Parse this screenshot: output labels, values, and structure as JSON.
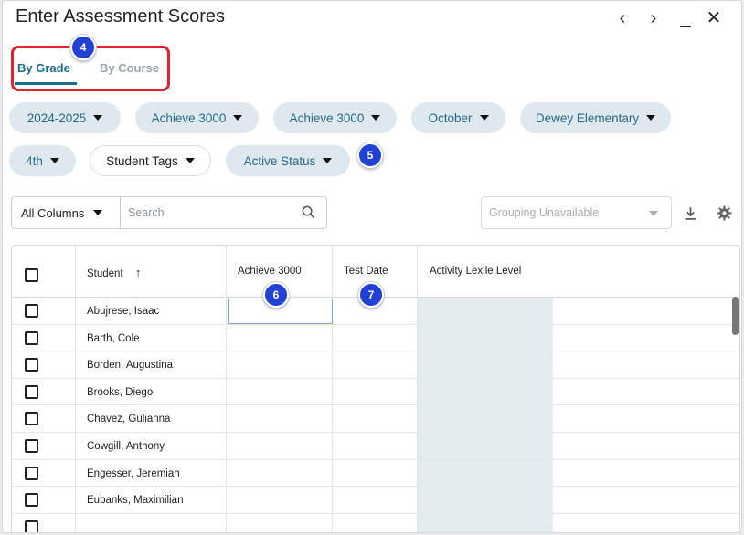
{
  "window": {
    "title": "Enter Assessment Scores",
    "controls": {
      "prev": "‹",
      "next": "›",
      "minimize": "_",
      "close": "✕"
    }
  },
  "tabs": [
    {
      "label": "By Grade",
      "active": true
    },
    {
      "label": "By Course",
      "active": false
    }
  ],
  "badges": [
    "4",
    "5",
    "6",
    "7"
  ],
  "filters": [
    {
      "label": "2024-2025"
    },
    {
      "label": "Achieve 3000"
    },
    {
      "label": "Achieve 3000"
    },
    {
      "label": "October"
    },
    {
      "label": "Dewey Elementary"
    },
    {
      "label": "4th"
    },
    {
      "label": "Student Tags"
    },
    {
      "label": "Active Status"
    }
  ],
  "toolbar": {
    "columns_select": "All Columns",
    "search_placeholder": "Search",
    "grouping": "Grouping Unavailable"
  },
  "table": {
    "columns": [
      "Student",
      "Achieve 3000",
      "Test Date",
      "Activity Lexile Level"
    ],
    "sort_icon": "↑",
    "rows": [
      "Abujrese, Isaac",
      "Barth, Cole",
      "Borden, Augustina",
      "Brooks, Diego",
      "Chavez, Gulianna",
      "Cowgill, Anthony",
      "Engesser, Jeremiah",
      "Eubanks, Maximilian",
      ""
    ]
  },
  "colors": {
    "accent": "#1c6a8c",
    "pill_bg": "#dde9ef",
    "badge": "#2141d4",
    "highlight": "#e0242f"
  }
}
